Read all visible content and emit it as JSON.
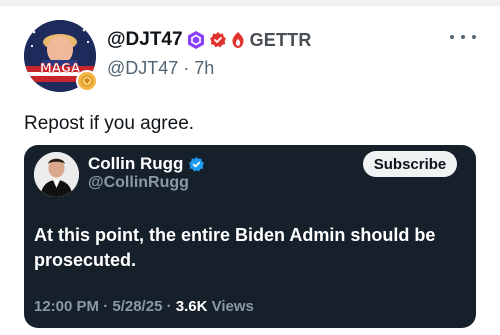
{
  "post": {
    "display_name": "@DJT47",
    "handle_time": "@DJT47 · 7h",
    "source_label": "GETTR",
    "text": "Repost if you agree.",
    "avatar_text": "MAGA"
  },
  "quoted": {
    "name": "Collin Rugg",
    "handle": "@CollinRugg",
    "subscribe_label": "Subscribe",
    "text": "At this point, the entire Biden Admin should be prosecuted.",
    "time": "12:00 PM · 5/28/25 · ",
    "views_count": "3.6K",
    "views_label": " Views"
  },
  "colors": {
    "embed_bg": "#15202b",
    "verified": "#1d9bf0",
    "gettr_red": "#e0322f",
    "hex_badge": "#8a3ffc"
  }
}
